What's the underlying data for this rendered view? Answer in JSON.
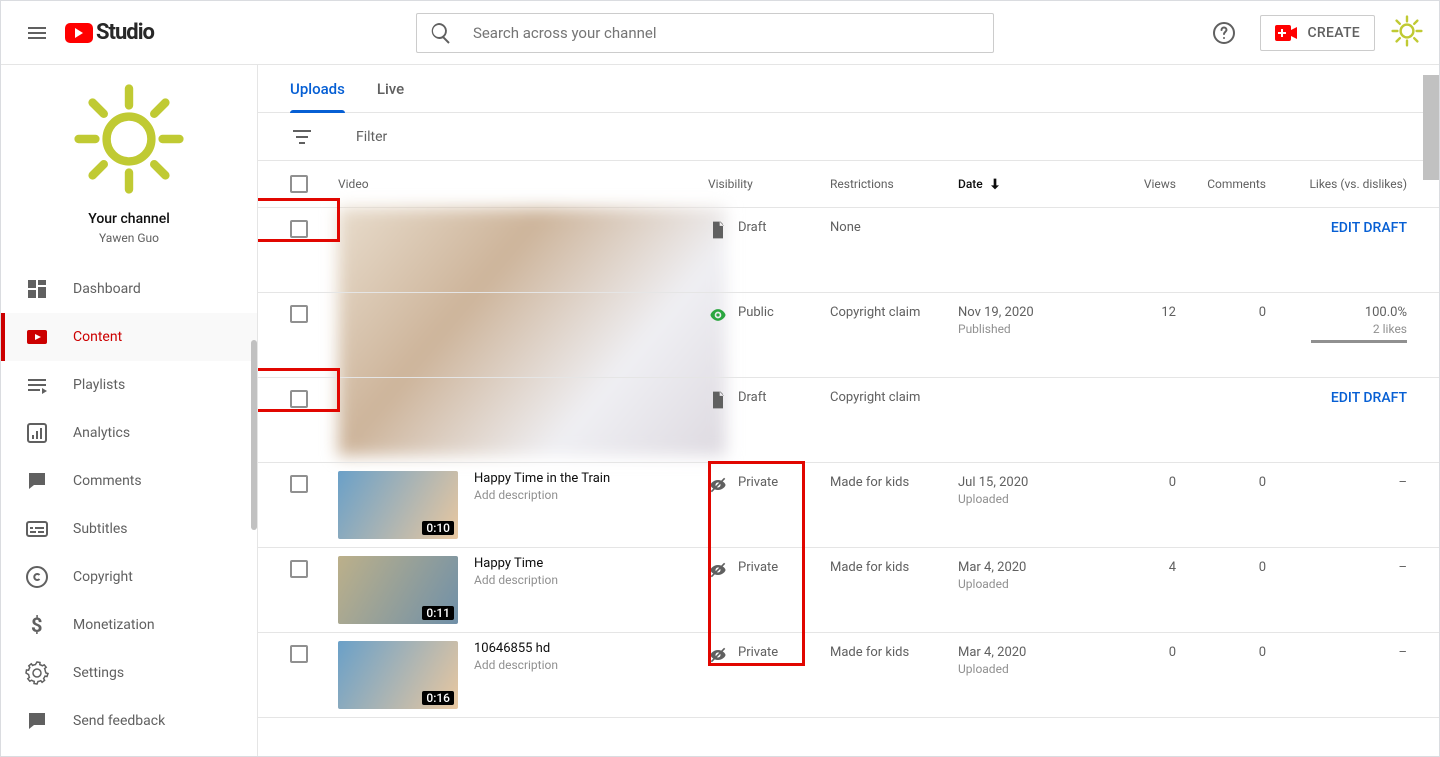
{
  "header": {
    "logo_text": "Studio",
    "search_placeholder": "Search across your channel",
    "create_label": "CREATE"
  },
  "channel": {
    "label": "Your channel",
    "name": "Yawen Guo"
  },
  "nav": [
    {
      "label": "Dashboard"
    },
    {
      "label": "Content"
    },
    {
      "label": "Playlists"
    },
    {
      "label": "Analytics"
    },
    {
      "label": "Comments"
    },
    {
      "label": "Subtitles"
    },
    {
      "label": "Copyright"
    },
    {
      "label": "Monetization"
    },
    {
      "label": "Settings"
    },
    {
      "label": "Send feedback"
    }
  ],
  "tabs": {
    "uploads": "Uploads",
    "live": "Live"
  },
  "filter_label": "Filter",
  "columns": {
    "video": "Video",
    "visibility": "Visibility",
    "restrictions": "Restrictions",
    "date": "Date",
    "views": "Views",
    "comments": "Comments",
    "likes": "Likes (vs. dislikes)"
  },
  "edit_draft": "EDIT DRAFT",
  "rows": [
    {
      "visibility": "Draft",
      "restrictions": "None"
    },
    {
      "visibility": "Public",
      "restrictions": "Copyright claim",
      "date": "Nov 19, 2020",
      "date_sub": "Published",
      "views": "12",
      "comments": "0",
      "likes": "100.0%",
      "likes_sub": "2 likes"
    },
    {
      "visibility": "Draft",
      "restrictions": "Copyright claim"
    },
    {
      "title": "Happy Time in the Train",
      "desc": "Add description",
      "duration": "0:10",
      "visibility": "Private",
      "restrictions": "Made for kids",
      "date": "Jul 15, 2020",
      "date_sub": "Uploaded",
      "views": "0",
      "comments": "0",
      "likes": "–"
    },
    {
      "title": "Happy Time",
      "desc": "Add description",
      "duration": "0:11",
      "visibility": "Private",
      "restrictions": "Made for kids",
      "date": "Mar 4, 2020",
      "date_sub": "Uploaded",
      "views": "4",
      "comments": "0",
      "likes": "–"
    },
    {
      "title": "10646855 hd",
      "desc": "Add description",
      "duration": "0:16",
      "visibility": "Private",
      "restrictions": "Made for kids",
      "date": "Mar 4, 2020",
      "date_sub": "Uploaded",
      "views": "0",
      "comments": "0",
      "likes": "–"
    }
  ]
}
